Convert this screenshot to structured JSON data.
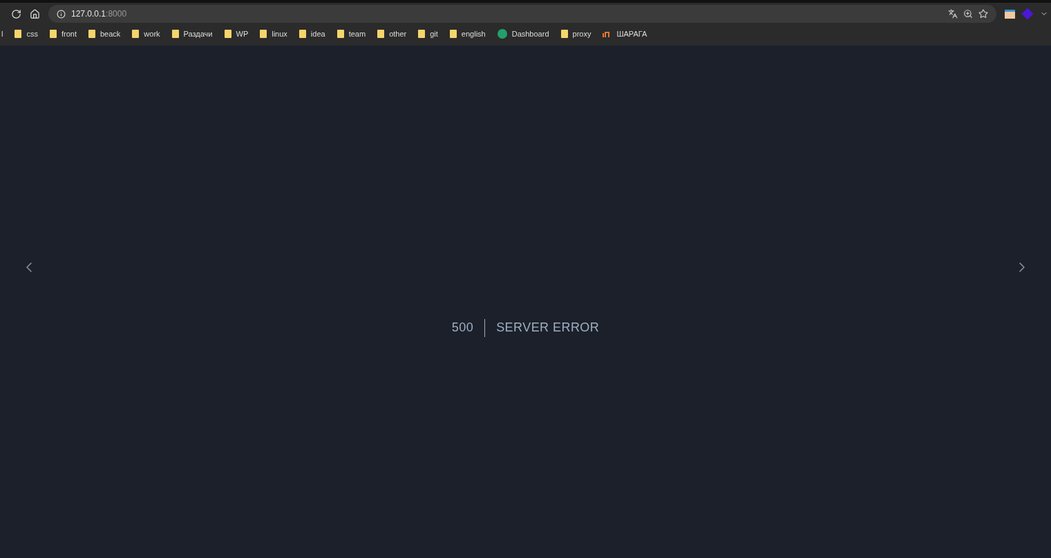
{
  "address_bar": {
    "host": "127.0.0.1",
    "port": ":8000"
  },
  "bookmarks": [
    {
      "kind": "plain",
      "label": "l"
    },
    {
      "kind": "folder",
      "label": "css"
    },
    {
      "kind": "folder",
      "label": "front"
    },
    {
      "kind": "folder",
      "label": "beack"
    },
    {
      "kind": "folder",
      "label": "work"
    },
    {
      "kind": "folder",
      "label": "Раздачи"
    },
    {
      "kind": "folder",
      "label": "WP"
    },
    {
      "kind": "folder",
      "label": "linux"
    },
    {
      "kind": "folder",
      "label": "idea"
    },
    {
      "kind": "folder",
      "label": "team"
    },
    {
      "kind": "folder",
      "label": "other"
    },
    {
      "kind": "folder",
      "label": "git"
    },
    {
      "kind": "folder",
      "label": "english"
    },
    {
      "kind": "site",
      "label": "Dashboard"
    },
    {
      "kind": "folder",
      "label": "proxy"
    },
    {
      "kind": "app",
      "label": "ШАРАГА"
    }
  ],
  "error": {
    "code": "500",
    "message": "SERVER ERROR"
  }
}
